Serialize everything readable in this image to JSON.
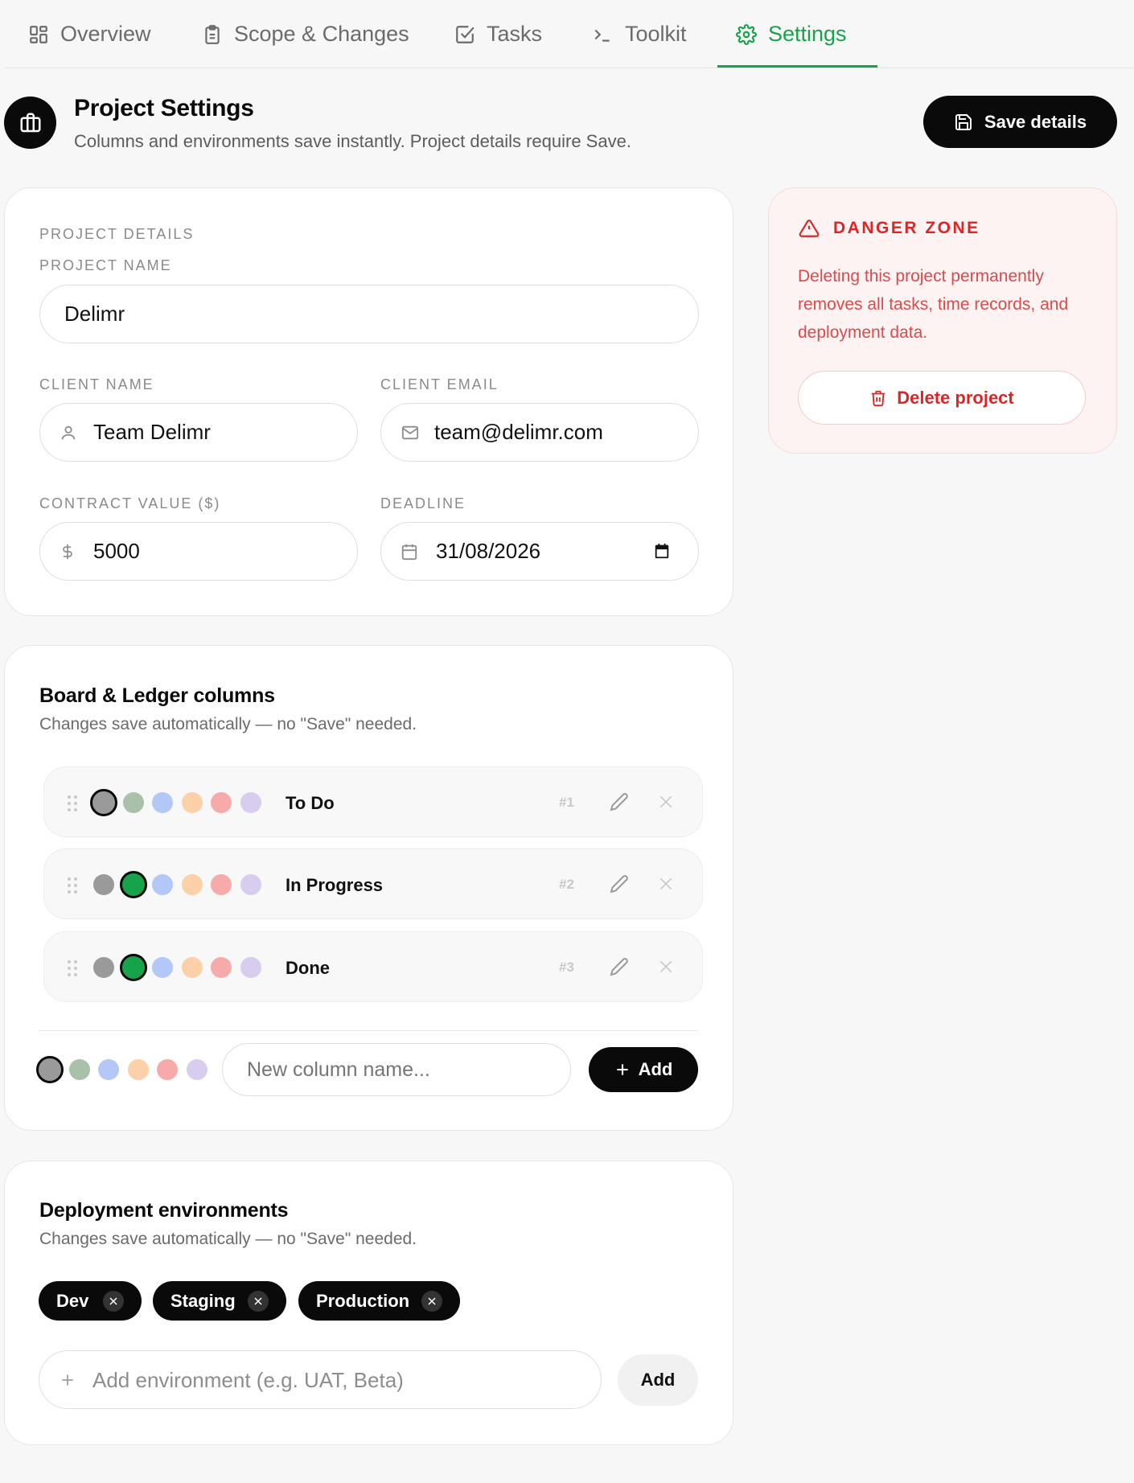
{
  "tabs": [
    {
      "label": "Overview",
      "icon": "grid-icon",
      "active": false
    },
    {
      "label": "Scope & Changes",
      "icon": "clipboard-icon",
      "active": false
    },
    {
      "label": "Tasks",
      "icon": "checkbox-icon",
      "active": false
    },
    {
      "label": "Toolkit",
      "icon": "terminal-icon",
      "active": false
    },
    {
      "label": "Settings",
      "icon": "gear-icon",
      "active": true
    }
  ],
  "header": {
    "title": "Project Settings",
    "subtitle": "Columns and environments save instantly. Project details require Save.",
    "save_label": "Save details"
  },
  "details": {
    "section_label": "PROJECT DETAILS",
    "project_name_label": "PROJECT NAME",
    "project_name": "Delimr",
    "client_name_label": "CLIENT NAME",
    "client_name": "Team Delimr",
    "client_email_label": "CLIENT EMAIL",
    "client_email": "team@delimr.com",
    "contract_label": "CONTRACT VALUE ($)",
    "contract_value": "5000",
    "deadline_label": "DEADLINE",
    "deadline": "31/08/2026"
  },
  "danger": {
    "title": "DANGER ZONE",
    "text": "Deleting this project permanently removes all tasks, time records, and deployment data.",
    "delete_label": "Delete project"
  },
  "columns_section": {
    "title": "Board & Ledger columns",
    "subtitle": "Changes save automatically — no \"Save\" needed.",
    "palette": [
      "#9a9a9a",
      "#a9c1a9",
      "#b3c8f7",
      "#fcd0a9",
      "#f6aaaa",
      "#d8cdee"
    ],
    "columns": [
      {
        "name": "To Do",
        "number": "#1",
        "selected": 0,
        "selected_color": "#9a9a9a"
      },
      {
        "name": "In Progress",
        "number": "#2",
        "selected": 1,
        "selected_color": "#16a34a"
      },
      {
        "name": "Done",
        "number": "#3",
        "selected": 1,
        "selected_color": "#16a34a"
      }
    ],
    "new_placeholder": "New column name...",
    "add_label": "Add"
  },
  "env_section": {
    "title": "Deployment environments",
    "subtitle": "Changes save automatically — no \"Save\" needed.",
    "environments": [
      "Dev",
      "Staging",
      "Production"
    ],
    "placeholder": "Add environment (e.g. UAT, Beta)",
    "add_label": "Add"
  },
  "colors": {
    "accent": "#16a34a",
    "danger": "#dc2626",
    "primary": "#0a0a0a"
  }
}
